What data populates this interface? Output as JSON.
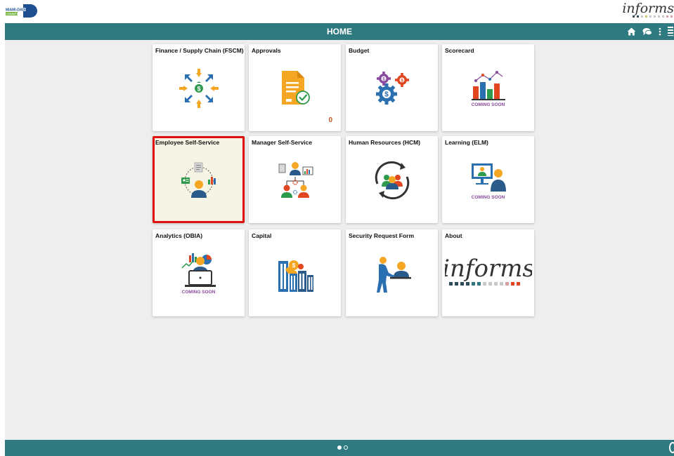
{
  "brand": {
    "county_logo_text_top": "MIAMI-DADE",
    "county_logo_text_bottom": "COUNTY",
    "app_logo_text": "informs"
  },
  "header": {
    "title": "HOME",
    "icons": [
      "home-icon",
      "chat-bubble-icon",
      "vertical-dots-icon",
      "nav-bar-icon"
    ]
  },
  "tiles": [
    {
      "title": "Finance / Supply Chain (FSCM)",
      "icon": "finance-arrows-icon"
    },
    {
      "title": "Approvals",
      "icon": "approval-document-icon",
      "count": "0"
    },
    {
      "title": "Budget",
      "icon": "gears-dollar-icon"
    },
    {
      "title": "Scorecard",
      "icon": "bar-chart-icon",
      "badge": "COMING SOON"
    },
    {
      "title": "Employee Self-Service",
      "icon": "employee-self-service-icon",
      "selected": true
    },
    {
      "title": "Manager Self-Service",
      "icon": "manager-org-chart-icon"
    },
    {
      "title": "Human Resources (HCM)",
      "icon": "people-cycle-icon"
    },
    {
      "title": "Learning (ELM)",
      "icon": "presentation-screen-icon",
      "badge": "COMING SOON"
    },
    {
      "title": "Analytics (OBIA)",
      "icon": "analytics-laptop-icon",
      "badge": "COMING SOON"
    },
    {
      "title": "Capital",
      "icon": "city-buildings-icon"
    },
    {
      "title": "Security Request Form",
      "icon": "service-desk-icon"
    },
    {
      "title": "About",
      "icon": "informs-logo",
      "logo_text": "informs"
    }
  ],
  "footer": {
    "pages": 2,
    "active_page": 1
  },
  "colors": {
    "header": "#2f7a80",
    "selected_border": "#e01010",
    "selected_bg": "#f6f4e4",
    "count": "#c0541c",
    "coming_soon": "#8a4a9e"
  }
}
